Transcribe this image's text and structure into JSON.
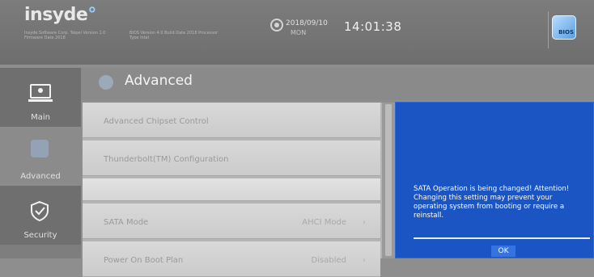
{
  "header": {
    "logo_text": "insyde",
    "logo_suffix": "°",
    "info_col1": "Insyde Software Corp. Taipei Version 1.0 Firmware Date 2018",
    "info_col2": "BIOS Version 4.0 Build Date 2018 Processor Type Intel",
    "date": "2018/09/10",
    "day": "MON",
    "time": "14:01:38",
    "bios_icon_label": "BIOS"
  },
  "nav": {
    "items": [
      {
        "label": "Main",
        "icon": "monitor-icon"
      },
      {
        "label": "Advanced",
        "icon": "advanced-icon"
      },
      {
        "label": "Security",
        "icon": "shield-icon"
      }
    ]
  },
  "page": {
    "title": "Advanced"
  },
  "rows": [
    {
      "label": "Advanced Chipset Control",
      "value": ""
    },
    {
      "label": "Thunderbolt(TM) Configuration",
      "value": ""
    },
    {
      "label": "",
      "value": ""
    },
    {
      "label": "SATA Mode",
      "value": "AHCI Mode",
      "chevron": "›"
    },
    {
      "label": "Power On Boot Plan",
      "value": "Disabled",
      "chevron": "›"
    }
  ],
  "dialog": {
    "message": "SATA Operation is being changed! Attention! Changing this setting may prevent your operating system from booting or require a reinstall.",
    "ok_label": "OK"
  },
  "colors": {
    "dialog_bg": "#1b55c4",
    "header_bg": "#7c7c7c"
  }
}
